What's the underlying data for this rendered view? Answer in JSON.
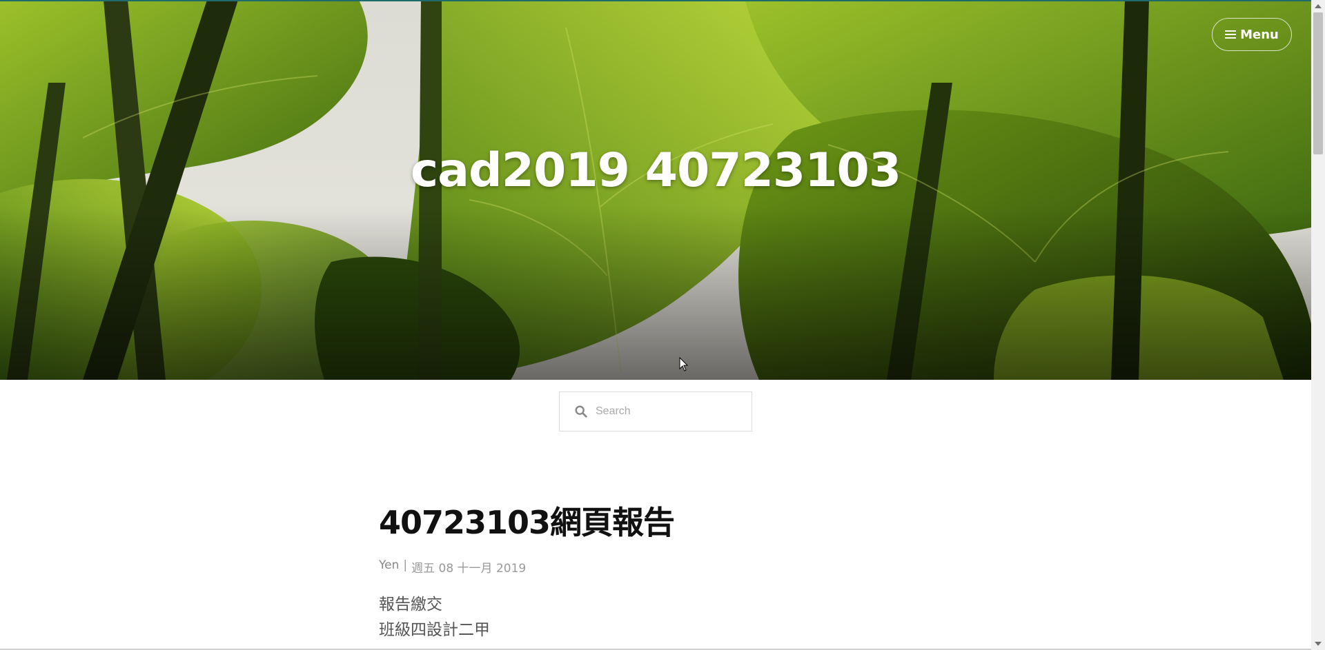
{
  "header": {
    "site_title": "cad2019 40723103",
    "menu_label": "Menu"
  },
  "search": {
    "placeholder": "Search"
  },
  "post": {
    "title": "40723103網頁報告",
    "author": "Yen",
    "separator": "|",
    "date": "週五 08 十一月 2019",
    "body_lines": [
      "報告繳交",
      "班級四設計二甲"
    ]
  },
  "colors": {
    "accent_top_edge": "#1f6b6b",
    "title_text": "#111111",
    "meta_text": "#999999",
    "body_text": "#555555"
  },
  "icons": {
    "menu": "hamburger-icon",
    "search": "magnifier-icon"
  }
}
